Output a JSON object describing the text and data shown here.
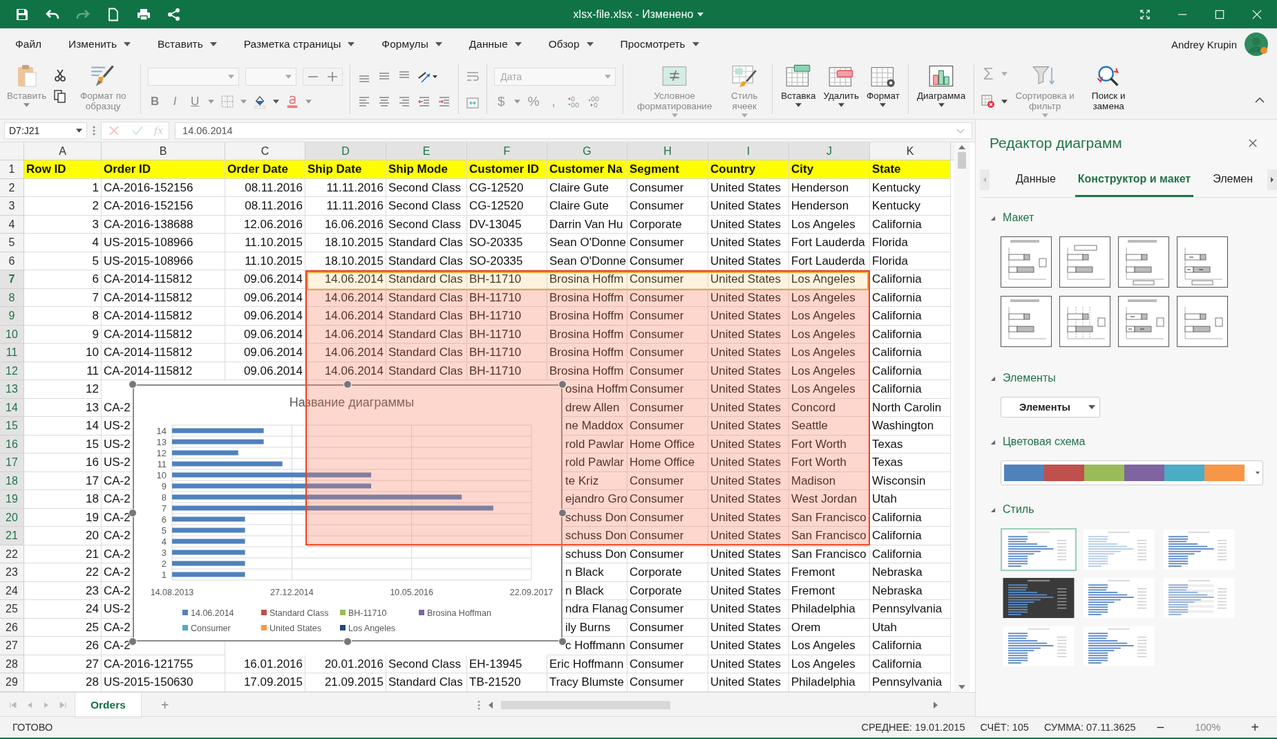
{
  "title_bar": {
    "title": "xlsx-file.xlsx - Изменено"
  },
  "menu": [
    {
      "label": "Файл",
      "has_menu": false
    },
    {
      "label": "Изменить",
      "has_menu": true
    },
    {
      "label": "Вставить",
      "has_menu": true
    },
    {
      "label": "Разметка страницы",
      "has_menu": true
    },
    {
      "label": "Формулы",
      "has_menu": true
    },
    {
      "label": "Данные",
      "has_menu": true
    },
    {
      "label": "Обзор",
      "has_menu": true
    },
    {
      "label": "Просмотреть",
      "has_menu": true
    }
  ],
  "user": {
    "name": "Andrey Krupin"
  },
  "ribbon": {
    "paste": {
      "label": "Вставить",
      "disabled": true
    },
    "format_painter": {
      "label": "Формат по образцу",
      "disabled": true
    },
    "font_style": [
      {
        "label": "B"
      },
      {
        "label": "I"
      },
      {
        "label": "U"
      }
    ],
    "number_format": {
      "placeholder": "Дата"
    },
    "number_symbols": [
      {
        "label": "$"
      },
      {
        "label": "%"
      },
      {
        "label": ","
      }
    ],
    "big_buttons": [
      {
        "kind": "conditional",
        "label": "Условное форматирование",
        "disabled": true,
        "dropdown": true
      },
      {
        "kind": "cell-style",
        "label": "Стиль ячеек",
        "disabled": true,
        "dropdown": true
      },
      {
        "kind": "insert-cells",
        "label": "Вставка",
        "disabled": false,
        "dropdown": true
      },
      {
        "kind": "delete-cells",
        "label": "Удалить",
        "disabled": false,
        "dropdown": true
      },
      {
        "kind": "format-cells",
        "label": "Формат",
        "disabled": false,
        "dropdown": true
      },
      {
        "kind": "chart",
        "label": "Диаграмма",
        "disabled": false,
        "dropdown": true
      }
    ],
    "sum": {
      "label": "Σ",
      "disabled": true
    },
    "sort": {
      "label": "Сортировка и фильтр",
      "disabled": true
    },
    "find": {
      "label": "Поиск и замена",
      "disabled": false
    }
  },
  "formula_bar": {
    "name_box": "D7:J21",
    "fx": "fx",
    "value": "14.06.2014"
  },
  "sheet": {
    "columns": [
      {
        "letter": "A",
        "kind": "number",
        "selected": false
      },
      {
        "letter": "B",
        "kind": "text",
        "selected": false
      },
      {
        "letter": "C",
        "kind": "date",
        "selected": false
      },
      {
        "letter": "D",
        "kind": "date",
        "selected": true
      },
      {
        "letter": "E",
        "kind": "text",
        "selected": true
      },
      {
        "letter": "F",
        "kind": "text",
        "selected": true
      },
      {
        "letter": "G",
        "kind": "text",
        "selected": true
      },
      {
        "letter": "H",
        "kind": "text",
        "selected": true
      },
      {
        "letter": "I",
        "kind": "text",
        "selected": true
      },
      {
        "letter": "J",
        "kind": "text",
        "selected": true
      },
      {
        "letter": "K",
        "kind": "text",
        "selected": false
      }
    ],
    "rows": [
      {
        "number": "1",
        "kind": "header",
        "selected": false,
        "active": false,
        "cells": [
          "Row ID",
          "Order ID",
          "Order Date",
          "Ship Date",
          "Ship Mode",
          "Customer ID",
          "Customer Na",
          "Segment",
          "Country",
          "City",
          "State"
        ]
      },
      {
        "number": "2",
        "kind": "data",
        "selected": false,
        "active": false,
        "cells": [
          "1",
          "CA-2016-152156",
          "08.11.2016",
          "11.11.2016",
          "Second Class",
          "CG-12520",
          "Claire Gute",
          "Consumer",
          "United States",
          "Henderson",
          "Kentucky"
        ]
      },
      {
        "number": "3",
        "kind": "data",
        "selected": false,
        "active": false,
        "cells": [
          "2",
          "CA-2016-152156",
          "08.11.2016",
          "11.11.2016",
          "Second Class",
          "CG-12520",
          "Claire Gute",
          "Consumer",
          "United States",
          "Henderson",
          "Kentucky"
        ]
      },
      {
        "number": "4",
        "kind": "data",
        "selected": false,
        "active": false,
        "cells": [
          "3",
          "CA-2016-138688",
          "12.06.2016",
          "16.06.2016",
          "Second Class",
          "DV-13045",
          "Darrin Van Hu",
          "Corporate",
          "United States",
          "Los Angeles",
          "California"
        ]
      },
      {
        "number": "5",
        "kind": "data",
        "selected": false,
        "active": false,
        "cells": [
          "4",
          "US-2015-108966",
          "11.10.2015",
          "18.10.2015",
          "Standard Clas",
          "SO-20335",
          "Sean O'Donne",
          "Consumer",
          "United States",
          "Fort Lauderda",
          "Florida"
        ]
      },
      {
        "number": "6",
        "kind": "data",
        "selected": false,
        "active": false,
        "cells": [
          "5",
          "US-2015-108966",
          "11.10.2015",
          "18.10.2015",
          "Standard Clas",
          "SO-20335",
          "Sean O'Donne",
          "Consumer",
          "United States",
          "Fort Lauderda",
          "Florida"
        ]
      },
      {
        "number": "7",
        "kind": "data",
        "selected": true,
        "active": true,
        "cells": [
          "6",
          "CA-2014-115812",
          "09.06.2014",
          "14.06.2014",
          "Standard Clas",
          "BH-11710",
          "Brosina Hoffm",
          "Consumer",
          "United States",
          "Los Angeles",
          "California"
        ]
      },
      {
        "number": "8",
        "kind": "data",
        "selected": true,
        "active": false,
        "cells": [
          "7",
          "CA-2014-115812",
          "09.06.2014",
          "14.06.2014",
          "Standard Clas",
          "BH-11710",
          "Brosina Hoffm",
          "Consumer",
          "United States",
          "Los Angeles",
          "California"
        ]
      },
      {
        "number": "9",
        "kind": "data",
        "selected": true,
        "active": false,
        "cells": [
          "8",
          "CA-2014-115812",
          "09.06.2014",
          "14.06.2014",
          "Standard Clas",
          "BH-11710",
          "Brosina Hoffm",
          "Consumer",
          "United States",
          "Los Angeles",
          "California"
        ]
      },
      {
        "number": "10",
        "kind": "data",
        "selected": true,
        "active": false,
        "cells": [
          "9",
          "CA-2014-115812",
          "09.06.2014",
          "14.06.2014",
          "Standard Clas",
          "BH-11710",
          "Brosina Hoffm",
          "Consumer",
          "United States",
          "Los Angeles",
          "California"
        ]
      },
      {
        "number": "11",
        "kind": "data",
        "selected": true,
        "active": false,
        "cells": [
          "10",
          "CA-2014-115812",
          "09.06.2014",
          "14.06.2014",
          "Standard Clas",
          "BH-11710",
          "Brosina Hoffm",
          "Consumer",
          "United States",
          "Los Angeles",
          "California"
        ]
      },
      {
        "number": "12",
        "kind": "data",
        "selected": true,
        "active": false,
        "cells": [
          "11",
          "CA-2014-115812",
          "09.06.2014",
          "14.06.2014",
          "Standard Clas",
          "BH-11710",
          "Brosina Hoffm",
          "Consumer",
          "United States",
          "Los Angeles",
          "California"
        ]
      },
      {
        "number": "13",
        "kind": "data",
        "selected": true,
        "active": false,
        "cells": [
          "12",
          null,
          null,
          null,
          null,
          null,
          "osina Hoffm",
          "Consumer",
          "United States",
          "Los Angeles",
          "California"
        ]
      },
      {
        "number": "14",
        "kind": "data",
        "selected": true,
        "active": false,
        "cells": [
          "13",
          "CA-2",
          null,
          null,
          null,
          null,
          "drew Allen",
          "Consumer",
          "United States",
          "Concord",
          "North Carolin"
        ]
      },
      {
        "number": "15",
        "kind": "data",
        "selected": true,
        "active": false,
        "cells": [
          "14",
          "US-2",
          null,
          null,
          null,
          null,
          "ne Maddox",
          "Consumer",
          "United States",
          "Seattle",
          "Washington"
        ]
      },
      {
        "number": "16",
        "kind": "data",
        "selected": true,
        "active": false,
        "cells": [
          "15",
          "US-2",
          null,
          null,
          null,
          null,
          "rold Pawlar",
          "Home Office",
          "United States",
          "Fort Worth",
          "Texas"
        ]
      },
      {
        "number": "17",
        "kind": "data",
        "selected": true,
        "active": false,
        "cells": [
          "16",
          "US-2",
          null,
          null,
          null,
          null,
          "rold Pawlar",
          "Home Office",
          "United States",
          "Fort Worth",
          "Texas"
        ]
      },
      {
        "number": "18",
        "kind": "data",
        "selected": true,
        "active": false,
        "cells": [
          "17",
          "CA-2",
          null,
          null,
          null,
          null,
          "te Kriz",
          "Consumer",
          "United States",
          "Madison",
          "Wisconsin"
        ]
      },
      {
        "number": "19",
        "kind": "data",
        "selected": true,
        "active": false,
        "cells": [
          "18",
          "CA-2",
          null,
          null,
          null,
          null,
          "ejandro Gro",
          "Consumer",
          "United States",
          "West Jordan",
          "Utah"
        ]
      },
      {
        "number": "20",
        "kind": "data",
        "selected": true,
        "active": false,
        "cells": [
          "19",
          "CA-2",
          null,
          null,
          null,
          null,
          "schuss Don",
          "Consumer",
          "United States",
          "San Francisco",
          "California"
        ]
      },
      {
        "number": "21",
        "kind": "data",
        "selected": true,
        "active": false,
        "cells": [
          "20",
          "CA-2",
          null,
          null,
          null,
          null,
          "schuss Don",
          "Consumer",
          "United States",
          "San Francisco",
          "California"
        ]
      },
      {
        "number": "22",
        "kind": "data",
        "selected": false,
        "active": false,
        "cells": [
          "21",
          "CA-2",
          null,
          null,
          null,
          null,
          "schuss Don",
          "Consumer",
          "United States",
          "San Francisco",
          "California"
        ]
      },
      {
        "number": "23",
        "kind": "data",
        "selected": false,
        "active": false,
        "cells": [
          "22",
          "CA-2",
          null,
          null,
          null,
          null,
          "n Black",
          "Corporate",
          "United States",
          "Fremont",
          "Nebraska"
        ]
      },
      {
        "number": "24",
        "kind": "data",
        "selected": false,
        "active": false,
        "cells": [
          "23",
          "CA-2",
          null,
          null,
          null,
          null,
          "n Black",
          "Corporate",
          "United States",
          "Fremont",
          "Nebraska"
        ]
      },
      {
        "number": "25",
        "kind": "data",
        "selected": false,
        "active": false,
        "cells": [
          "24",
          "US-2",
          null,
          null,
          null,
          null,
          "ndra Flanag",
          "Consumer",
          "United States",
          "Philadelphia",
          "Pennsylvania"
        ]
      },
      {
        "number": "26",
        "kind": "data",
        "selected": false,
        "active": false,
        "cells": [
          "25",
          "CA-2",
          null,
          null,
          null,
          null,
          "ily Burns",
          "Consumer",
          "United States",
          "Orem",
          "Utah"
        ]
      },
      {
        "number": "27",
        "kind": "data",
        "selected": false,
        "active": false,
        "cells": [
          "26",
          "CA-2",
          null,
          null,
          null,
          null,
          "c Hoffmann",
          "Consumer",
          "United States",
          "Los Angeles",
          "California"
        ]
      },
      {
        "number": "28",
        "kind": "data",
        "selected": false,
        "active": false,
        "cells": [
          "27",
          "CA-2016-121755",
          "16.01.2016",
          "20.01.2016",
          "Second Class",
          "EH-13945",
          "Eric Hoffmann",
          "Consumer",
          "United States",
          "Los Angeles",
          "California"
        ]
      },
      {
        "number": "29",
        "kind": "data",
        "selected": false,
        "active": false,
        "cells": [
          "28",
          "US-2015-150630",
          "17.09.2015",
          "21.09.2015",
          "Standard Clas",
          "TB-21520",
          "Tracy Blumste",
          "Consumer",
          "United States",
          "Philadelphia",
          "Pennsylvania"
        ]
      }
    ]
  },
  "chart": {
    "selected": true,
    "title": "Название диаграммы",
    "y_labels": [
      "14",
      "13",
      "12",
      "11",
      "10",
      "9",
      "8",
      "7",
      "6",
      "5",
      "4",
      "3",
      "2",
      "1"
    ],
    "legend": [
      {
        "name": "14.06.2014",
        "color": "#4f81bd"
      },
      {
        "name": "Standard Class",
        "color": "#c0504d"
      },
      {
        "name": "BH-11710",
        "color": "#9bbb59"
      },
      {
        "name": "Brosina Hoffman",
        "color": "#8064a2"
      },
      {
        "name": "Consumer",
        "color": "#4bacc6"
      },
      {
        "name": "United States",
        "color": "#f79646"
      },
      {
        "name": "Los Angeles",
        "color": "#1f497d"
      }
    ],
    "x_labels": [
      "14.08.2013",
      "27.12.2014",
      "10.05.2016",
      "22.09.2017"
    ]
  },
  "panel": {
    "title": "Редактор диаграмм",
    "tabs": [
      {
        "label": "Данные",
        "selected": false
      },
      {
        "label": "Конструктор и макет",
        "selected": true
      },
      {
        "label": "Элемен",
        "selected": false
      }
    ],
    "sections": [
      {
        "kind": "layouts",
        "title": "Макет",
        "expanded": true,
        "layouts": [
          {
            "kind": "title-legend-right"
          },
          {
            "kind": "legend-top"
          },
          {
            "kind": "title-legend-bottom"
          },
          {
            "kind": "labels-legend-bottom"
          },
          {
            "kind": "title-only"
          },
          {
            "kind": "gridlines-legend-right"
          },
          {
            "kind": "title-labels-legend-right"
          },
          {
            "kind": "legend-right"
          }
        ]
      },
      {
        "kind": "elements",
        "title": "Элементы",
        "expanded": true,
        "dropdown": "Элементы"
      },
      {
        "kind": "colors",
        "title": "Цветовая схема",
        "expanded": true,
        "colors": [
          {
            "color": "#4f81bd"
          },
          {
            "color": "#c0504d"
          },
          {
            "color": "#9bbb59"
          },
          {
            "color": "#8064a2"
          },
          {
            "color": "#4bacc6"
          },
          {
            "color": "#f79646"
          }
        ]
      },
      {
        "kind": "styles",
        "title": "Стиль",
        "expanded": true,
        "styles": [
          {
            "kind": "plain",
            "selected": true
          },
          {
            "kind": "pale",
            "selected": false
          },
          {
            "kind": "plain",
            "selected": false
          },
          {
            "kind": "dark",
            "selected": false
          },
          {
            "kind": "plain",
            "selected": false
          },
          {
            "kind": "banded",
            "selected": false
          },
          {
            "kind": "plain",
            "selected": false
          },
          {
            "kind": "plain",
            "selected": false
          }
        ]
      }
    ]
  },
  "sheet_tabs": {
    "tabs": [
      {
        "label": "Orders",
        "selected": true
      }
    ],
    "add": "+"
  },
  "status_bar": {
    "state": "ГОТОВО",
    "average": "СРЕДНЕЕ: 19.01.2015",
    "count": "СЧЁТ: 105",
    "sum": "СУММА: 07.11.3625",
    "zoom_out": "−",
    "zoom": "100%",
    "zoom_in": "+"
  }
}
